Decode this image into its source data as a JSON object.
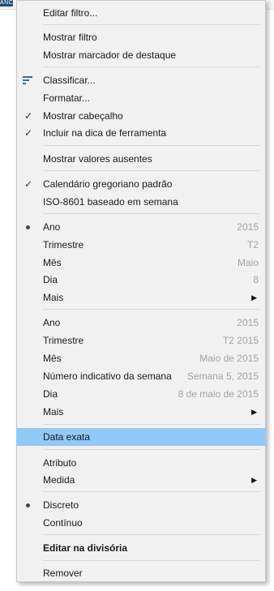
{
  "background": {
    "tab_text": "ANC"
  },
  "menu": {
    "edit_filter": "Editar filtro...",
    "show_filter": "Mostrar filtro",
    "show_highlighter": "Mostrar marcador de destaque",
    "sort": "Classificar...",
    "format": "Formatar...",
    "show_header": "Mostrar cabeçalho",
    "include_tooltip": "Incluir na dica de ferramenta",
    "show_missing": "Mostrar valores ausentes",
    "gregorian": "Calendário gregoriano padrão",
    "iso_week": "ISO-8601 baseado em semana",
    "date_parts": [
      {
        "label": "Ano",
        "value": "2015"
      },
      {
        "label": "Trimestre",
        "value": "T2"
      },
      {
        "label": "Mês",
        "value": "Maio"
      },
      {
        "label": "Dia",
        "value": "8"
      },
      {
        "label": "Mais",
        "value": ""
      }
    ],
    "date_values": [
      {
        "label": "Ano",
        "value": "2015"
      },
      {
        "label": "Trimestre",
        "value": "T2 2015"
      },
      {
        "label": "Mês",
        "value": "Maio de 2015"
      },
      {
        "label": "Número indicativo da semana",
        "value": "Semana 5, 2015"
      },
      {
        "label": "Dia",
        "value": "8 de maio de 2015"
      },
      {
        "label": "Mais",
        "value": ""
      }
    ],
    "exact_date": "Data exata",
    "attribute": "Atributo",
    "measure": "Medida",
    "discrete": "Discreto",
    "continuous": "Contínuo",
    "edit_in_shelf": "Editar na divisória",
    "remove": "Remover"
  },
  "colors": {
    "highlight": "#91c9f7",
    "menu_bg": "#f1f1f1"
  }
}
